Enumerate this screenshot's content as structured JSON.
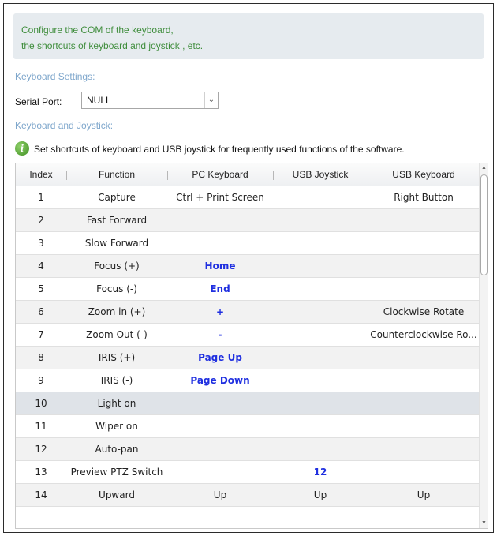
{
  "intro": {
    "line1": "Configure the COM of the keyboard,",
    "line2": "the shortcuts of keyboard and joystick , etc."
  },
  "keyboard_settings": {
    "title": "Keyboard Settings:",
    "serial_port_label": "Serial Port:",
    "serial_port_value": "NULL"
  },
  "keyboard_joystick": {
    "title": "Keyboard and Joystick:",
    "info": "Set shortcuts of keyboard and USB joystick for frequently used functions of the software."
  },
  "table": {
    "headers": [
      "Index",
      "Function",
      "PC Keyboard",
      "USB Joystick",
      "USB Keyboard"
    ],
    "rows": [
      [
        "1",
        "Capture",
        "Ctrl + Print Screen",
        "",
        "Right Button"
      ],
      [
        "2",
        "Fast Forward",
        "",
        "",
        ""
      ],
      [
        "3",
        "Slow Forward",
        "",
        "",
        ""
      ],
      [
        "4",
        "Focus (+)",
        "Home",
        "",
        ""
      ],
      [
        "5",
        "Focus (-)",
        "End",
        "",
        ""
      ],
      [
        "6",
        "Zoom in (+)",
        "+",
        "",
        "Clockwise Rotate"
      ],
      [
        "7",
        "Zoom Out (-)",
        "-",
        "",
        "Counterclockwise Ro..."
      ],
      [
        "8",
        "IRIS (+)",
        "Page Up",
        "",
        ""
      ],
      [
        "9",
        "IRIS (-)",
        "Page Down",
        "",
        ""
      ],
      [
        "10",
        "Light on",
        "",
        "",
        ""
      ],
      [
        "11",
        "Wiper on",
        "",
        "",
        ""
      ],
      [
        "12",
        "Auto-pan",
        "",
        "",
        ""
      ],
      [
        "13",
        "Preview PTZ Switch",
        "",
        "12",
        ""
      ],
      [
        "14",
        "Upward",
        "Up",
        "Up",
        "Up"
      ]
    ],
    "highlighted": [
      [
        "4",
        2
      ],
      [
        "5",
        2
      ],
      [
        "6",
        2
      ],
      [
        "7",
        2
      ],
      [
        "8",
        2
      ],
      [
        "9",
        2
      ],
      [
        "13",
        3
      ]
    ],
    "selected_row": "10"
  },
  "colors": {
    "intro_text": "#3f8d3c",
    "section_title": "#7fa7cc",
    "highlight_text": "#1f2fe0",
    "selected_row_bg": "#dfe3e8"
  },
  "icons": {
    "info": "info-icon",
    "dropdown": "chevron-down-icon",
    "scroll_up": "scroll-up-icon",
    "scroll_down": "scroll-down-icon"
  }
}
